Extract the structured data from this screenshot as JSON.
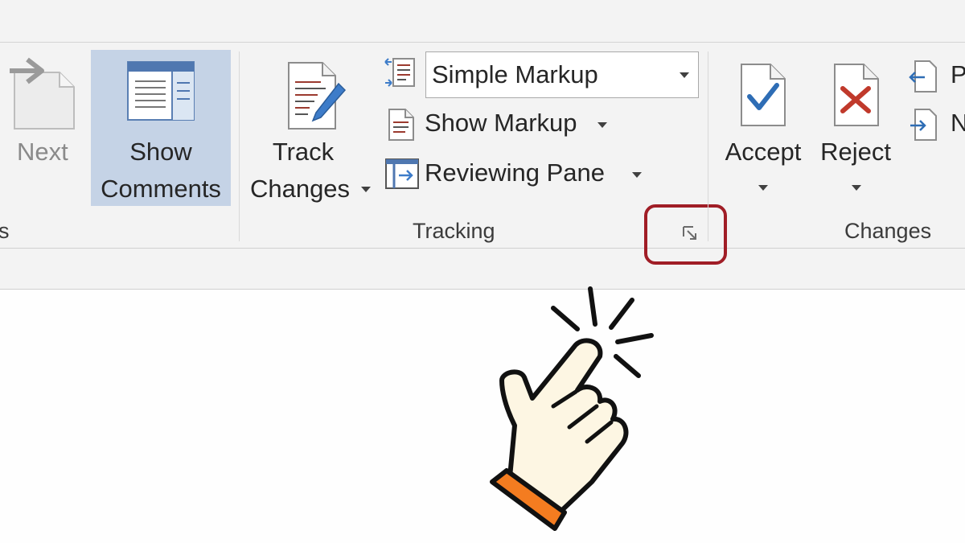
{
  "ribbon": {
    "comments_group": {
      "partial_label": "s",
      "next_label": "Next",
      "show_comments": {
        "line1": "Show",
        "line2": "Comments"
      }
    },
    "tracking_group": {
      "label": "Tracking",
      "track_changes": {
        "line1": "Track",
        "line2": "Changes"
      },
      "markup_dropdown_value": "Simple Markup",
      "show_markup_label": "Show Markup",
      "reviewing_pane_label": "Reviewing Pane"
    },
    "changes_group": {
      "label": "Changes",
      "accept_label": "Accept",
      "reject_label": "Reject",
      "previous_partial": "P",
      "next_partial": "N"
    }
  },
  "colors": {
    "selected_button_bg": "#c5d3e6",
    "highlight_border": "#a01d26",
    "accept_check": "#2e6db5",
    "reject_x": "#c0392b",
    "cursor_cuff": "#f47c20",
    "cursor_skin": "#fdf6e3"
  },
  "icons": [
    "next-comment-icon",
    "show-comments-icon",
    "track-changes-icon",
    "display-for-review-icon",
    "show-markup-icon",
    "reviewing-pane-icon",
    "accept-icon",
    "reject-icon",
    "previous-change-icon",
    "next-change-icon",
    "dialog-launcher-icon",
    "pointing-hand-cursor-icon"
  ]
}
